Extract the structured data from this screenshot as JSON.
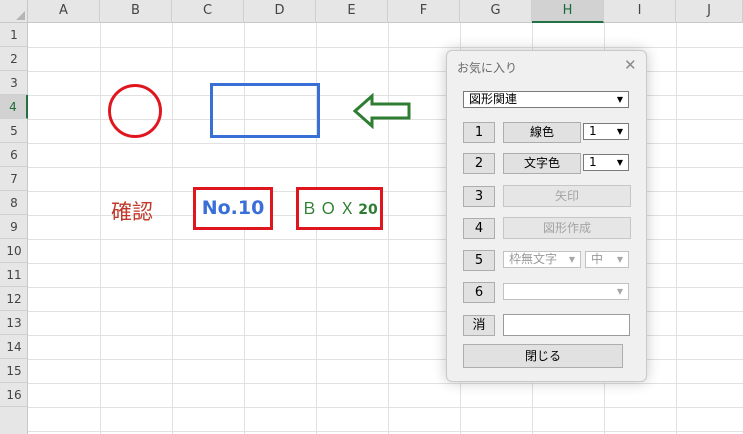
{
  "sheet": {
    "columns": [
      "A",
      "B",
      "C",
      "D",
      "E",
      "F",
      "G",
      "H",
      "I",
      "J"
    ],
    "selected_column": "H",
    "rows": [
      "1",
      "2",
      "3",
      "4",
      "5",
      "6",
      "7",
      "8",
      "9",
      "10",
      "11",
      "12",
      "13",
      "14",
      "15",
      "16"
    ],
    "selected_row": "4"
  },
  "shapes": {
    "kakunin_text": "確認",
    "no10_text": "No.10",
    "box_text": "ＢＯＸ",
    "box_number": "20",
    "colors": {
      "circle": "#e0161e",
      "rectangle": "#3a6fd8",
      "arrow": "#2e7d32",
      "frame_red": "#e0161e"
    }
  },
  "dialog": {
    "title": "お気に入り",
    "close_icon": "close-icon",
    "category_select": "図形関連",
    "rows": [
      {
        "num": "1",
        "action": "線色",
        "value": "1"
      },
      {
        "num": "2",
        "action": "文字色",
        "value": "1"
      },
      {
        "num": "3",
        "action": "矢印"
      },
      {
        "num": "4",
        "action": "図形作成"
      },
      {
        "num": "5",
        "select_a": "枠無文字",
        "select_b": "中"
      },
      {
        "num": "6",
        "select_c": ""
      }
    ],
    "clear_label": "消",
    "clear_input_value": "",
    "close_button": "閉じる"
  }
}
